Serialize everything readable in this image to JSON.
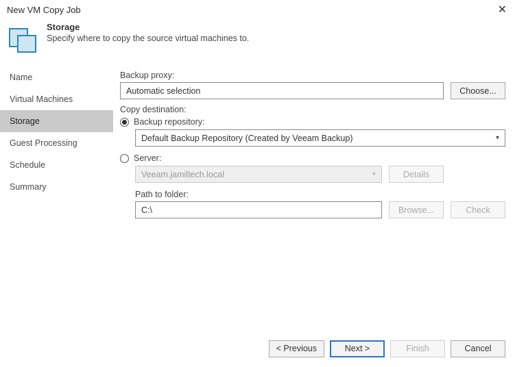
{
  "window": {
    "title": "New VM Copy Job"
  },
  "header": {
    "title": "Storage",
    "subtitle": "Specify where to copy the source virtual machines to."
  },
  "sidebar": {
    "items": [
      {
        "label": "Name"
      },
      {
        "label": "Virtual Machines"
      },
      {
        "label": "Storage"
      },
      {
        "label": "Guest Processing"
      },
      {
        "label": "Schedule"
      },
      {
        "label": "Summary"
      }
    ],
    "active_index": 2
  },
  "content": {
    "backup_proxy_label": "Backup proxy:",
    "backup_proxy_value": "Automatic selection",
    "choose_label": "Choose...",
    "copy_dest_label": "Copy destination:",
    "radio_repo_label": "Backup repository:",
    "repo_selected": "Default Backup Repository (Created by Veeam Backup)",
    "radio_server_label": "Server:",
    "server_value": "Veeam.jamiltech.local",
    "details_label": "Details",
    "path_label": "Path to folder:",
    "path_value": "C:\\",
    "browse_label": "Browse...",
    "check_label": "Check"
  },
  "footer": {
    "previous": "< Previous",
    "next": "Next >",
    "finish": "Finish",
    "cancel": "Cancel"
  }
}
